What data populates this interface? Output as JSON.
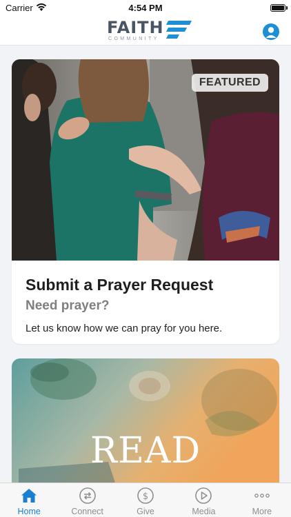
{
  "status_bar": {
    "carrier": "Carrier",
    "time": "4:54 PM",
    "battery_level": 1.0
  },
  "header": {
    "logo_word": "FAITH",
    "logo_subtext": "COMMUNITY",
    "brand_color": "#1f8fd3",
    "logo_text_color": "#4a5563"
  },
  "featured_card": {
    "badge": "FEATURED",
    "title": "Submit a Prayer Request",
    "subtitle": "Need prayer?",
    "description": "Let us know how we can pray for you here."
  },
  "read_card": {
    "title": "READ"
  },
  "tabs": [
    {
      "label": "Home",
      "icon": "home-icon",
      "active": true
    },
    {
      "label": "Connect",
      "icon": "connect-icon",
      "active": false
    },
    {
      "label": "Give",
      "icon": "give-icon",
      "active": false
    },
    {
      "label": "Media",
      "icon": "media-icon",
      "active": false
    },
    {
      "label": "More",
      "icon": "more-icon",
      "active": false
    }
  ],
  "colors": {
    "accent": "#1a7fd1",
    "inactive": "#8e8e93",
    "background": "#f2f3f7"
  }
}
